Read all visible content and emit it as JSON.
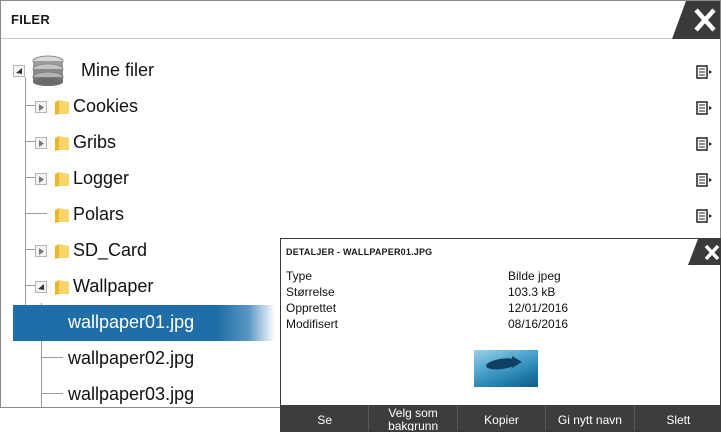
{
  "window": {
    "title": "FILER"
  },
  "tree": {
    "root": {
      "label": "Mine filer",
      "icon": "database-icon"
    },
    "items": [
      {
        "label": "Cookies",
        "icon": "folder-icon"
      },
      {
        "label": "Gribs",
        "icon": "folder-icon"
      },
      {
        "label": "Logger",
        "icon": "folder-icon"
      },
      {
        "label": "Polars",
        "icon": "folder-icon"
      },
      {
        "label": "SD_Card",
        "icon": "folder-icon"
      },
      {
        "label": "Wallpaper",
        "icon": "folder-icon"
      }
    ],
    "files": [
      {
        "label": "wallpaper01.jpg",
        "selected": true
      },
      {
        "label": "wallpaper02.jpg",
        "selected": false
      },
      {
        "label": "wallpaper03.jpg",
        "selected": false
      }
    ]
  },
  "details": {
    "title": "DETALJER - WALLPAPER01.JPG",
    "properties": [
      {
        "key": "Type",
        "value": "Bilde jpeg"
      },
      {
        "key": "Størrelse",
        "value": "103.3 kB"
      },
      {
        "key": "Opprettet",
        "value": "12/01/2016"
      },
      {
        "key": "Modifisert",
        "value": "08/16/2016"
      }
    ],
    "buttons": [
      {
        "label": "Se"
      },
      {
        "label": "Velg som bakgrunn"
      },
      {
        "label": "Kopier"
      },
      {
        "label": "Gi nytt navn"
      },
      {
        "label": "Slett"
      }
    ]
  },
  "colors": {
    "selection": "#1f6ea8",
    "button_bar": "#3d3d3d",
    "close_tab": "#3a3a3a"
  }
}
